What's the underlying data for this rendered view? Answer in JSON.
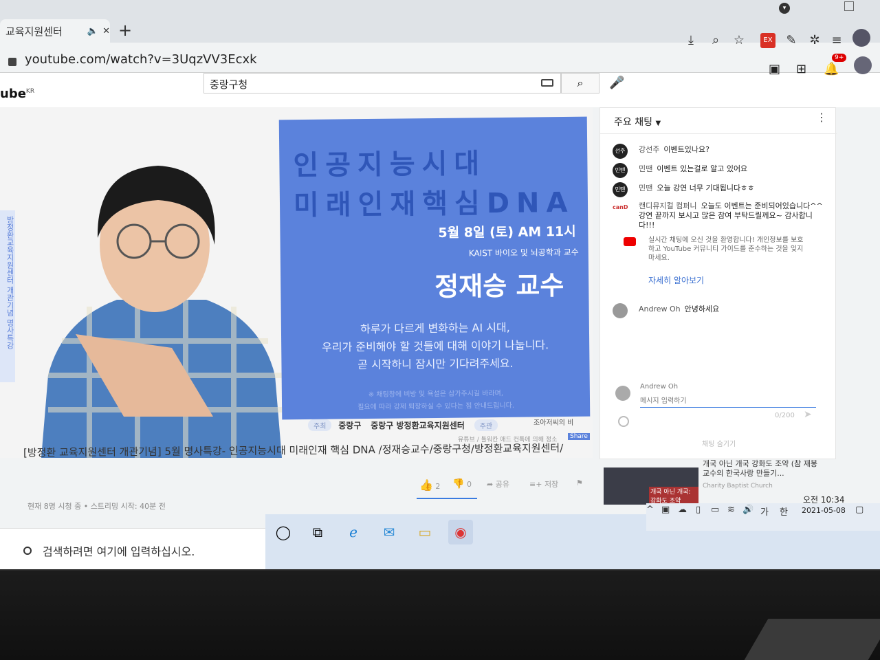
{
  "browser": {
    "tab_title": "교육지원센터",
    "url": "youtube.com/watch?v=3UqzVV3Ecxk",
    "extension_label": "EX"
  },
  "youtube": {
    "logo_text": "ube",
    "logo_country": "KR",
    "search_value": "중랑구청",
    "notification_count": "9+"
  },
  "poster": {
    "title_line1": "인공지능시대",
    "title_line2": "미래인재핵심DNA",
    "date": "5월 8일 (토) AM 11시",
    "affiliation": "KAIST 바이오 및 뇌공학과 교수",
    "name": "정재승 교수",
    "line1": "하루가 다르게 변화하는 AI 시대,",
    "line2": "우리가 준비해야 할 것들에 대해 이야기 나눕니다.",
    "line3": "곧 시작하니 잠시만 기다려주세요.",
    "note1": "※ 채팅창에 비방 및 욕설은 삼가주시길 바라며,",
    "note2": "필요에 따라 강제 퇴장하실 수 있다는 점 안내드립니다.",
    "side_vertical": "방정환교육지원센터 개관기념 명사특강",
    "logos": [
      "주최",
      "중랑구",
      "중랑구 방정환교육지원센터",
      "주관"
    ],
    "logo_right": "조아저씨의 비",
    "youtube_note": "유튜브 / 틀워칸 애드 컨톡에 의해 정소",
    "share_label": "Share"
  },
  "video": {
    "title": "[방정환 교육지원센터 개관기념] 5월 명사특강- 인공지능시대 미래인재 핵심 DNA /정재승교수/중랑구청/방정환교육지원센터/",
    "meta": "현재 8명 시청 중 • 스트리밍 시작: 40분 전",
    "likes": "2",
    "dislikes": "0",
    "share_label": "공유",
    "save_label": "저장"
  },
  "chat": {
    "title": "주요 채팅",
    "messages": [
      {
        "avatar": "선주",
        "author": "강선주",
        "text": "이벤트있나요?"
      },
      {
        "avatar": "민땐",
        "author": "민땐",
        "text": "이벤트 있는걸로 알고 있어요"
      },
      {
        "avatar": "민땐",
        "author": "민땐",
        "text": "오늘 강연 너무 기대됩니다ㅎㅎ"
      },
      {
        "avatar": "canD",
        "author": "캔디뮤지컬 컴퍼니",
        "text": "오늘도 이벤트는 준비되어있습니다^^ 강연 끝까지 보시고 많은 참여 부탁드릴께요~ 감사합니다!!!"
      }
    ],
    "welcome": "실시간 채팅에 오신 것을 환영합니다! 개인정보를 보호하고 YouTube 커뮤니티 가이드를 준수하는 것을 잊지 마세요.",
    "learn_more": "자세히 알아보기",
    "andrew_message": {
      "author": "Andrew Oh",
      "text": "안녕하세요"
    },
    "input_author": "Andrew Oh",
    "input_placeholder": "메시지 입력하기",
    "char_count": "0/200",
    "hide_label": "채팅 숨기기"
  },
  "recommendation": {
    "title": "개국 아닌 개국 강화도 조약 (참 재봉 교수의 한국사랑 만들기...",
    "channel": "Charity Baptist Church",
    "thumb_text": "개국 아닌 개국: 강화도 조약"
  },
  "taskbar": {
    "search_placeholder": "검색하려면 여기에 입력하십시오.",
    "time": "오전 10:34",
    "date": "2021-05-08",
    "ime_ga": "가",
    "ime_han": "한"
  }
}
